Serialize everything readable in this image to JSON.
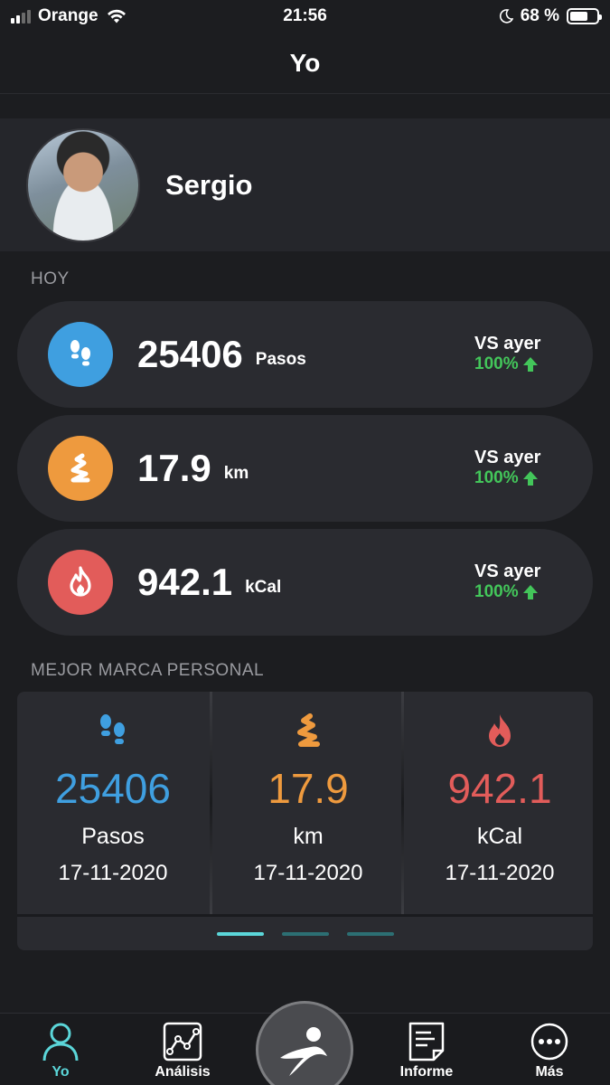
{
  "status_bar": {
    "carrier": "Orange",
    "time": "21:56",
    "battery": "68 %",
    "battery_level": 0.68
  },
  "nav": {
    "title": "Yo"
  },
  "profile": {
    "name": "Sergio"
  },
  "today": {
    "section_label": "HOY",
    "stats": [
      {
        "value": "25406",
        "unit": "Pasos",
        "compare_label": "VS ayer",
        "compare_value": "100%",
        "color": "#3f9fe0",
        "icon": "footprints-icon"
      },
      {
        "value": "17.9",
        "unit": "km",
        "compare_label": "VS ayer",
        "compare_value": "100%",
        "color": "#ee9a3e",
        "icon": "route-icon"
      },
      {
        "value": "942.1",
        "unit": "kCal",
        "compare_label": "VS ayer",
        "compare_value": "100%",
        "color": "#e25c5a",
        "icon": "flame-icon"
      }
    ]
  },
  "records": {
    "section_label": "MEJOR MARCA PERSONAL",
    "items": [
      {
        "value": "25406",
        "unit": "Pasos",
        "date": "17-11-2020",
        "color": "#3f9fe0",
        "icon": "footprints-icon"
      },
      {
        "value": "17.9",
        "unit": "km",
        "date": "17-11-2020",
        "color": "#ee9a3e",
        "icon": "route-icon"
      },
      {
        "value": "942.1",
        "unit": "kCal",
        "date": "17-11-2020",
        "color": "#e25c5a",
        "icon": "flame-icon"
      }
    ],
    "page_count": 3,
    "active_page": 1
  },
  "tab_bar": {
    "tabs": [
      {
        "label": "Yo",
        "icon": "person-icon",
        "active": true
      },
      {
        "label": "Análisis",
        "icon": "chart-icon",
        "active": false
      },
      {
        "label": "Informe",
        "icon": "report-icon",
        "active": false
      },
      {
        "label": "Más",
        "icon": "more-icon",
        "active": false
      }
    ],
    "active_color": "#5bd6d9"
  }
}
